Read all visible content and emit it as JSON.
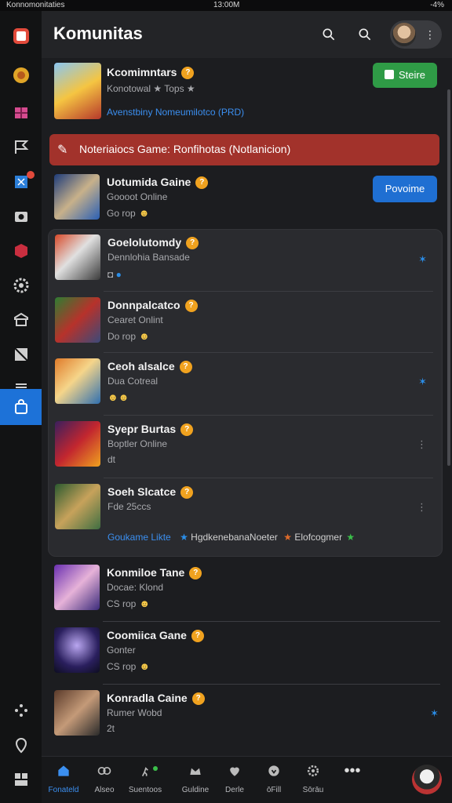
{
  "status_bar": {
    "left_text": "Konnomonitaties",
    "time": "13:00M",
    "battery": "-4%"
  },
  "header": {
    "title": "Komunitas",
    "avatar_menu": "⋮"
  },
  "featured": {
    "title": "Kcomimntars",
    "subtitle": "Konotowal ★ Tops ★",
    "link": "Avenstbiny Nomeumilotco (PRD)",
    "button": "Steire"
  },
  "banner": {
    "text": "Noteriaiocs Game: Ronfihotas (Notlanicion)"
  },
  "game1": {
    "title": "Uotumida Gaine",
    "sub": "Goooot Online",
    "meta": "Go rop",
    "button": "Povoime"
  },
  "list": [
    {
      "title": "Goelolutomdy",
      "sub": "Dennlohia Bansade",
      "meta": ""
    },
    {
      "title": "Donnpalcatco",
      "sub": "Cearet Onlint",
      "meta": "Do rop"
    },
    {
      "title": "Ceoh alsalce",
      "sub": "Dua Cotreal",
      "meta": ""
    },
    {
      "title": "Syepr Burtas",
      "sub": "Boptler Online",
      "meta": "dt"
    },
    {
      "title": "Soeh Slcatce",
      "sub": "Fde 25ccs",
      "meta": ""
    }
  ],
  "card_footer": {
    "left": "Goukame Likte",
    "middle": "HgdkenebanaNoeter",
    "right": "Elofcogmer"
  },
  "more_list": [
    {
      "title": "Konmiloe Tane",
      "sub": "Docae: Klond",
      "meta": "CS rop"
    },
    {
      "title": "Coomiica Gane",
      "sub": "Gonter",
      "meta": "CS rop"
    },
    {
      "title": "Konradla Caine",
      "sub": "Rumer Wobd",
      "meta": "2t"
    }
  ],
  "bottom_nav": [
    {
      "label": "Fonateld"
    },
    {
      "label": "Alseo"
    },
    {
      "label": "Suentoos"
    },
    {
      "label": "Guldine"
    },
    {
      "label": "Derle"
    },
    {
      "label": "ōFill"
    },
    {
      "label": "Sōrāu"
    },
    {
      "label": "•••"
    }
  ],
  "colors": {
    "accent": "#1d72d8",
    "green": "#2f9b46",
    "banner": "#a2322b"
  }
}
